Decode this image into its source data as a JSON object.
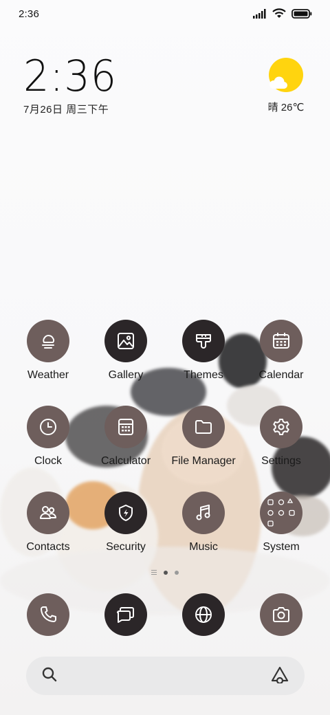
{
  "status_bar": {
    "time": "2:36",
    "icons": [
      "signal-icon",
      "wifi-icon",
      "battery-icon"
    ]
  },
  "clock_widget": {
    "time": "2:36",
    "date": "7月26日 周三下午"
  },
  "weather_widget": {
    "condition_icon": "sun-cloud-icon",
    "text": "晴 26℃"
  },
  "apps": [
    {
      "label": "Weather",
      "icon": "weather-icon"
    },
    {
      "label": "Gallery",
      "icon": "gallery-icon"
    },
    {
      "label": "Themes",
      "icon": "themes-icon"
    },
    {
      "label": "Calendar",
      "icon": "calendar-icon"
    },
    {
      "label": "Clock",
      "icon": "clock-icon"
    },
    {
      "label": "Calculator",
      "icon": "calculator-icon"
    },
    {
      "label": "File Manager",
      "icon": "folder-icon"
    },
    {
      "label": "Settings",
      "icon": "gear-icon"
    },
    {
      "label": "Contacts",
      "icon": "contacts-icon"
    },
    {
      "label": "Security",
      "icon": "shield-icon"
    },
    {
      "label": "Music",
      "icon": "music-icon"
    },
    {
      "label": "System",
      "icon": "folder-grid-icon"
    }
  ],
  "dock": [
    {
      "icon": "phone-icon"
    },
    {
      "icon": "messages-icon"
    },
    {
      "icon": "browser-icon"
    },
    {
      "icon": "camera-icon"
    }
  ],
  "page_indicator": {
    "pages": 2,
    "active_page": 1
  },
  "search_bar": {
    "left_icon": "search-icon",
    "right_icon": "assistant-icon"
  },
  "colors": {
    "icon_mauve": "#6e5e5c",
    "icon_dark": "#2b2628",
    "sun": "#ffd40f",
    "search_bg": "#e9e9ea"
  }
}
